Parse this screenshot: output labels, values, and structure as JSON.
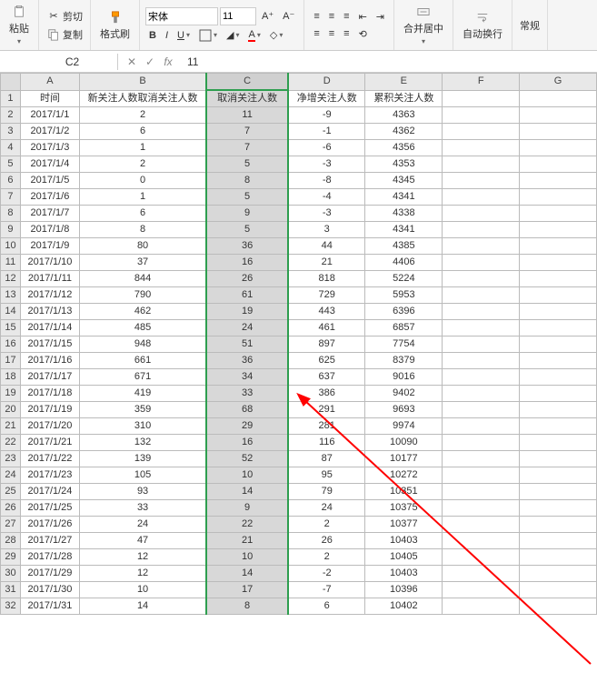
{
  "toolbar": {
    "paste": "粘贴",
    "cut": "剪切",
    "copy": "复制",
    "format_painter": "格式刷",
    "font_name": "宋体",
    "font_size": "11",
    "merge_center": "合并居中",
    "wrap_text": "自动换行",
    "normal": "常规"
  },
  "formula_bar": {
    "name_box": "C2",
    "fx": "fx",
    "value": "11"
  },
  "columns": [
    "A",
    "B",
    "C",
    "D",
    "E",
    "F",
    "G"
  ],
  "headers": {
    "A": "时间",
    "B": "新关注人数取消关注人数",
    "C": "取消关注人数",
    "D": "净增关注人数",
    "E": "累积关注人数"
  },
  "rows": [
    {
      "n": 1
    },
    {
      "n": 2,
      "A": "2017/1/1",
      "B": "2",
      "C": "11",
      "D": "-9",
      "E": "4363"
    },
    {
      "n": 3,
      "A": "2017/1/2",
      "B": "6",
      "C": "7",
      "D": "-1",
      "E": "4362"
    },
    {
      "n": 4,
      "A": "2017/1/3",
      "B": "1",
      "C": "7",
      "D": "-6",
      "E": "4356"
    },
    {
      "n": 5,
      "A": "2017/1/4",
      "B": "2",
      "C": "5",
      "D": "-3",
      "E": "4353"
    },
    {
      "n": 6,
      "A": "2017/1/5",
      "B": "0",
      "C": "8",
      "D": "-8",
      "E": "4345"
    },
    {
      "n": 7,
      "A": "2017/1/6",
      "B": "1",
      "C": "5",
      "D": "-4",
      "E": "4341"
    },
    {
      "n": 8,
      "A": "2017/1/7",
      "B": "6",
      "C": "9",
      "D": "-3",
      "E": "4338"
    },
    {
      "n": 9,
      "A": "2017/1/8",
      "B": "8",
      "C": "5",
      "D": "3",
      "E": "4341"
    },
    {
      "n": 10,
      "A": "2017/1/9",
      "B": "80",
      "C": "36",
      "D": "44",
      "E": "4385"
    },
    {
      "n": 11,
      "A": "2017/1/10",
      "B": "37",
      "C": "16",
      "D": "21",
      "E": "4406"
    },
    {
      "n": 12,
      "A": "2017/1/11",
      "B": "844",
      "C": "26",
      "D": "818",
      "E": "5224"
    },
    {
      "n": 13,
      "A": "2017/1/12",
      "B": "790",
      "C": "61",
      "D": "729",
      "E": "5953"
    },
    {
      "n": 14,
      "A": "2017/1/13",
      "B": "462",
      "C": "19",
      "D": "443",
      "E": "6396"
    },
    {
      "n": 15,
      "A": "2017/1/14",
      "B": "485",
      "C": "24",
      "D": "461",
      "E": "6857"
    },
    {
      "n": 16,
      "A": "2017/1/15",
      "B": "948",
      "C": "51",
      "D": "897",
      "E": "7754"
    },
    {
      "n": 17,
      "A": "2017/1/16",
      "B": "661",
      "C": "36",
      "D": "625",
      "E": "8379"
    },
    {
      "n": 18,
      "A": "2017/1/17",
      "B": "671",
      "C": "34",
      "D": "637",
      "E": "9016"
    },
    {
      "n": 19,
      "A": "2017/1/18",
      "B": "419",
      "C": "33",
      "D": "386",
      "E": "9402"
    },
    {
      "n": 20,
      "A": "2017/1/19",
      "B": "359",
      "C": "68",
      "D": "291",
      "E": "9693"
    },
    {
      "n": 21,
      "A": "2017/1/20",
      "B": "310",
      "C": "29",
      "D": "281",
      "E": "9974"
    },
    {
      "n": 22,
      "A": "2017/1/21",
      "B": "132",
      "C": "16",
      "D": "116",
      "E": "10090"
    },
    {
      "n": 23,
      "A": "2017/1/22",
      "B": "139",
      "C": "52",
      "D": "87",
      "E": "10177"
    },
    {
      "n": 24,
      "A": "2017/1/23",
      "B": "105",
      "C": "10",
      "D": "95",
      "E": "10272"
    },
    {
      "n": 25,
      "A": "2017/1/24",
      "B": "93",
      "C": "14",
      "D": "79",
      "E": "10351"
    },
    {
      "n": 26,
      "A": "2017/1/25",
      "B": "33",
      "C": "9",
      "D": "24",
      "E": "10375"
    },
    {
      "n": 27,
      "A": "2017/1/26",
      "B": "24",
      "C": "22",
      "D": "2",
      "E": "10377"
    },
    {
      "n": 28,
      "A": "2017/1/27",
      "B": "47",
      "C": "21",
      "D": "26",
      "E": "10403"
    },
    {
      "n": 29,
      "A": "2017/1/28",
      "B": "12",
      "C": "10",
      "D": "2",
      "E": "10405"
    },
    {
      "n": 30,
      "A": "2017/1/29",
      "B": "12",
      "C": "14",
      "D": "-2",
      "E": "10403"
    },
    {
      "n": 31,
      "A": "2017/1/30",
      "B": "10",
      "C": "17",
      "D": "-7",
      "E": "10396"
    },
    {
      "n": 32,
      "A": "2017/1/31",
      "B": "14",
      "C": "8",
      "D": "6",
      "E": "10402"
    }
  ]
}
